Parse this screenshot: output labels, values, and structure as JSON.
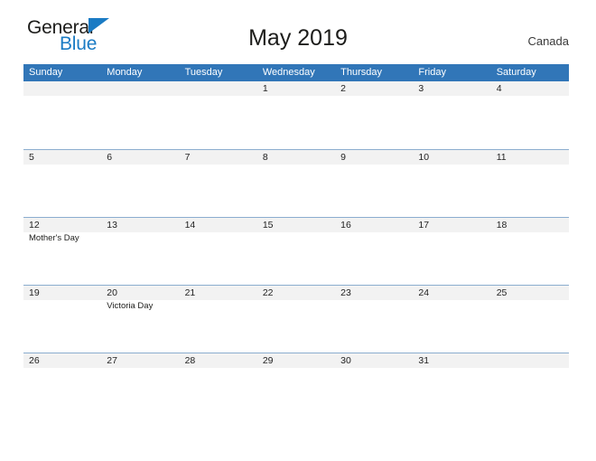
{
  "brand": {
    "name_top": "General",
    "name_bottom": "Blue",
    "accent_color": "#1a7bc4"
  },
  "header": {
    "title": "May 2019",
    "country": "Canada"
  },
  "theme": {
    "header_blue": "#3176b8",
    "row_line": "#8badcf",
    "date_band": "#f2f2f2"
  },
  "calendar": {
    "weekdays": [
      "Sunday",
      "Monday",
      "Tuesday",
      "Wednesday",
      "Thursday",
      "Friday",
      "Saturday"
    ],
    "weeks": [
      {
        "days": [
          {
            "date": "",
            "event": ""
          },
          {
            "date": "",
            "event": ""
          },
          {
            "date": "",
            "event": ""
          },
          {
            "date": "1",
            "event": ""
          },
          {
            "date": "2",
            "event": ""
          },
          {
            "date": "3",
            "event": ""
          },
          {
            "date": "4",
            "event": ""
          }
        ]
      },
      {
        "days": [
          {
            "date": "5",
            "event": ""
          },
          {
            "date": "6",
            "event": ""
          },
          {
            "date": "7",
            "event": ""
          },
          {
            "date": "8",
            "event": ""
          },
          {
            "date": "9",
            "event": ""
          },
          {
            "date": "10",
            "event": ""
          },
          {
            "date": "11",
            "event": ""
          }
        ]
      },
      {
        "days": [
          {
            "date": "12",
            "event": "Mother's Day"
          },
          {
            "date": "13",
            "event": ""
          },
          {
            "date": "14",
            "event": ""
          },
          {
            "date": "15",
            "event": ""
          },
          {
            "date": "16",
            "event": ""
          },
          {
            "date": "17",
            "event": ""
          },
          {
            "date": "18",
            "event": ""
          }
        ]
      },
      {
        "days": [
          {
            "date": "19",
            "event": ""
          },
          {
            "date": "20",
            "event": "Victoria Day"
          },
          {
            "date": "21",
            "event": ""
          },
          {
            "date": "22",
            "event": ""
          },
          {
            "date": "23",
            "event": ""
          },
          {
            "date": "24",
            "event": ""
          },
          {
            "date": "25",
            "event": ""
          }
        ]
      },
      {
        "days": [
          {
            "date": "26",
            "event": ""
          },
          {
            "date": "27",
            "event": ""
          },
          {
            "date": "28",
            "event": ""
          },
          {
            "date": "29",
            "event": ""
          },
          {
            "date": "30",
            "event": ""
          },
          {
            "date": "31",
            "event": ""
          },
          {
            "date": "",
            "event": ""
          }
        ]
      }
    ]
  }
}
